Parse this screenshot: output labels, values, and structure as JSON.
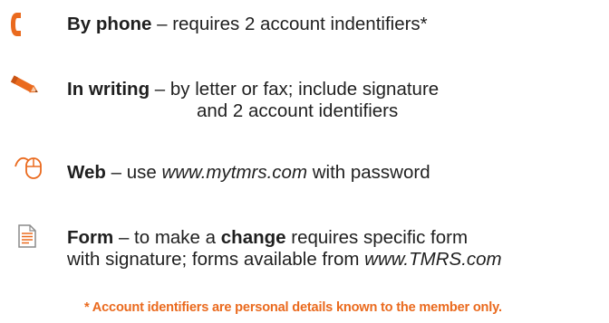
{
  "colors": {
    "accent": "#ea6a1e",
    "text": "#1f1f1f",
    "icon_gray": "#8a8a8a"
  },
  "items": [
    {
      "icon": "phone-icon",
      "label": "By phone",
      "text": " – requires 2 account indentifiers*"
    },
    {
      "icon": "pencil-icon",
      "label": "In writing",
      "text_line1": " – by letter or fax; include signature",
      "text_line2": "and 2 account identifiers"
    },
    {
      "icon": "mouse-icon",
      "label": "Web",
      "text_pre": " – use ",
      "link": "www.mytmrs.com",
      "text_post": " with password"
    },
    {
      "icon": "document-icon",
      "label": "Form",
      "text_pre": " – to make a ",
      "emphasis": "change",
      "text_post": " requires specific form",
      "line2_pre": "with signature; forms available from ",
      "line2_link": "www.TMRS.com"
    }
  ],
  "footnote": "* Account identifiers are personal details known to the member only."
}
